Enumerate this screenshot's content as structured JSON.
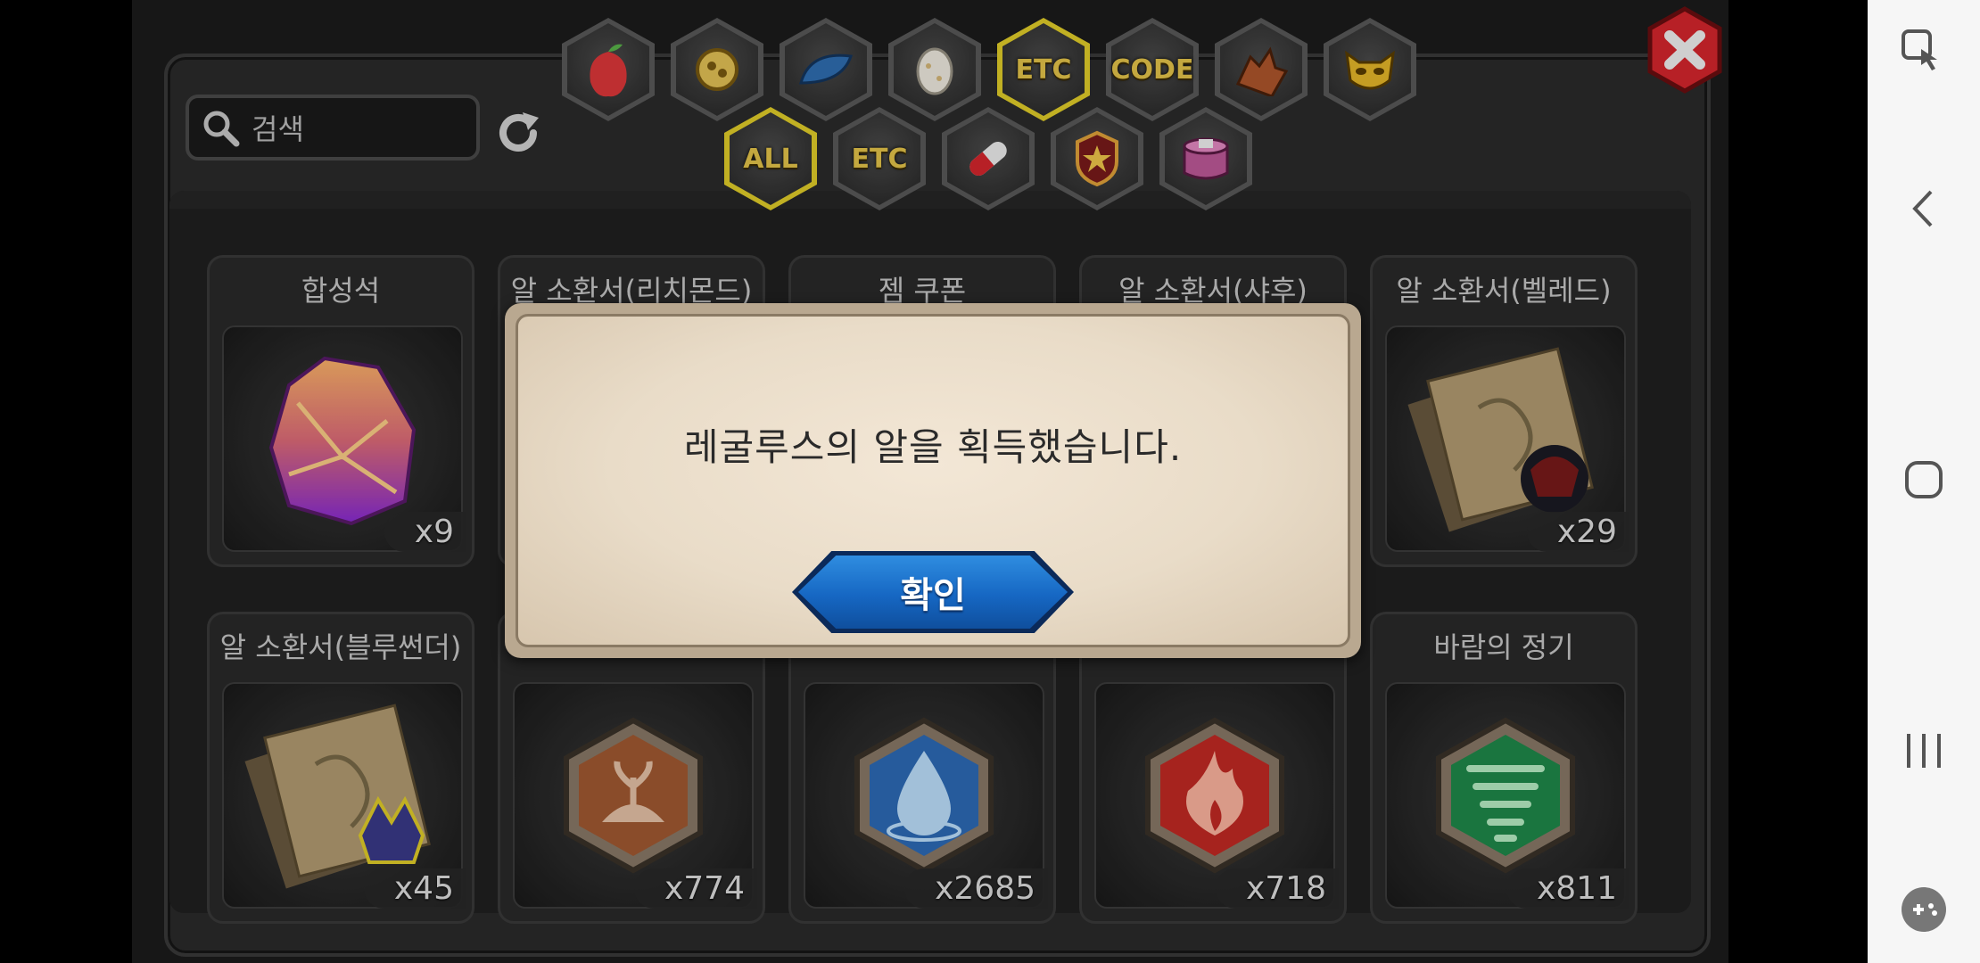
{
  "search": {
    "placeholder": "검색"
  },
  "tabs_top": [
    {
      "id": "fruit",
      "icon": "fruit-icon"
    },
    {
      "id": "ore",
      "icon": "ore-icon"
    },
    {
      "id": "scale",
      "icon": "dragon-scale-icon"
    },
    {
      "id": "egg",
      "icon": "egg-icon"
    },
    {
      "id": "etc",
      "label": "ETC",
      "selected": true
    },
    {
      "id": "code",
      "label": "CODE"
    },
    {
      "id": "dragon",
      "icon": "dragon-head-icon"
    },
    {
      "id": "mask",
      "icon": "mask-icon"
    }
  ],
  "tabs_sub": [
    {
      "id": "all",
      "label": "ALL",
      "selected": true
    },
    {
      "id": "etc",
      "label": "ETC"
    },
    {
      "id": "pill",
      "icon": "pill-icon"
    },
    {
      "id": "badge",
      "icon": "star-badge-icon"
    },
    {
      "id": "gift",
      "icon": "gift-box-icon"
    }
  ],
  "items": [
    {
      "title": "합성석",
      "qty": "x9",
      "icon": "crystal-stone-icon"
    },
    {
      "title": "알 소환서(리치몬드)",
      "qty": "",
      "icon": ""
    },
    {
      "title": "젬 쿠폰",
      "qty": "",
      "icon": ""
    },
    {
      "title": "알 소환서(샤후)",
      "qty": "",
      "icon": ""
    },
    {
      "title": "알 소환서(벨레드)",
      "qty": "x29",
      "icon": "summon-scroll-icon"
    },
    {
      "title": "알 소환서(블루썬더)",
      "qty": "x45",
      "icon": "summon-scroll-icon"
    },
    {
      "title": "",
      "qty": "x774",
      "icon": "earth-essence-icon"
    },
    {
      "title": "",
      "qty": "x2685",
      "icon": "water-essence-icon"
    },
    {
      "title": "",
      "qty": "x718",
      "icon": "fire-essence-icon"
    },
    {
      "title": "바람의 정기",
      "qty": "x811",
      "icon": "wind-essence-icon"
    }
  ],
  "dialog": {
    "message": "레굴루스의 알을 획득했습니다.",
    "confirm_label": "확인"
  },
  "colors": {
    "selected_border": "#e3cf2a",
    "tab_label": "#e7c64a",
    "confirm_blue": "#1667c3",
    "close_red": "#d8262d"
  },
  "navbar": [
    "touch-icon",
    "back-icon",
    "home-icon",
    "recents-icon",
    "game-tools-icon"
  ]
}
